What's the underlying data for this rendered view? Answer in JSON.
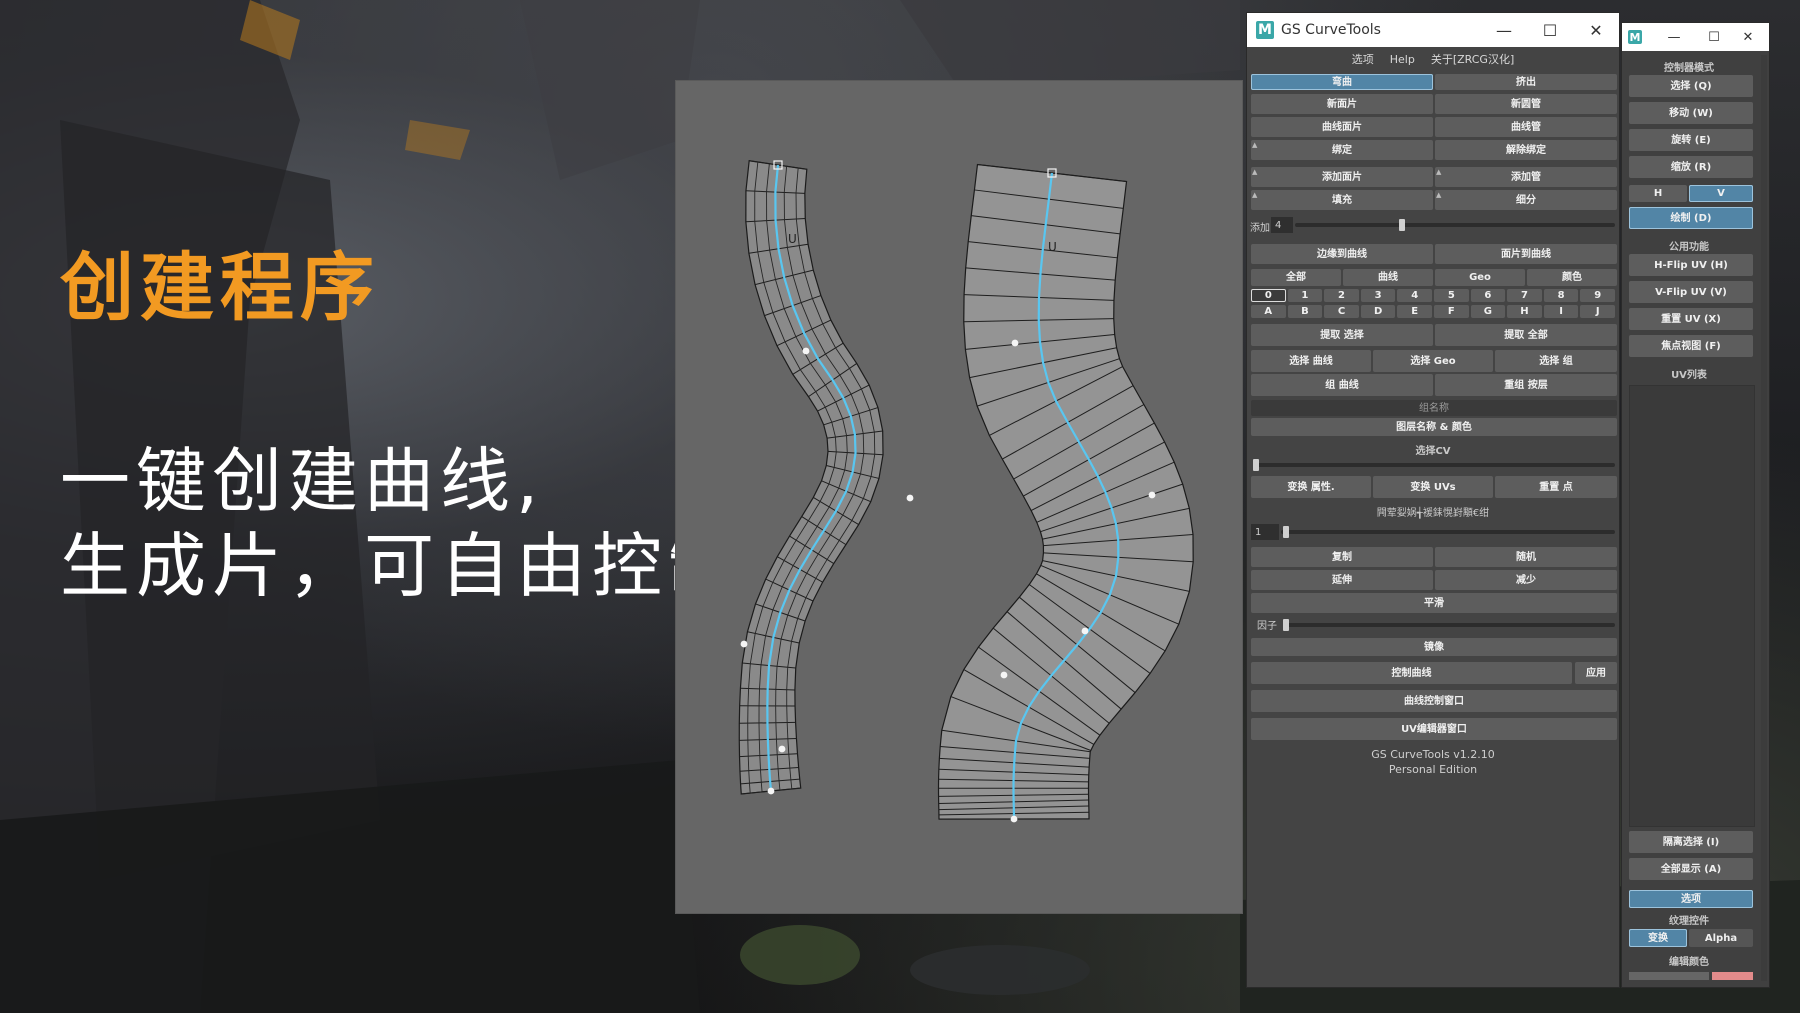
{
  "slide": {
    "headline": "创建程序",
    "subline_1": "一键创建曲线,",
    "subline_2": "生成片，可自由控制"
  },
  "colors": {
    "headline": "#f29a22",
    "curve": "#59c6f0",
    "active_button": "#5285a6",
    "panel": "#444444"
  },
  "viewport": {
    "marker_label": "U"
  },
  "main_window": {
    "title": "GS CurveTools",
    "menu": [
      "选项",
      "Help",
      "关于[ZRCG汉化]"
    ],
    "buttons": {
      "warp": "弯曲",
      "extrude": "挤出",
      "new_card": "新面片",
      "new_tube": "新圆管",
      "curve_card": "曲线面片",
      "curve_tube": "曲线管",
      "bind": "绑定",
      "unbind": "解除绑定",
      "add_card": "添加面片",
      "add_tube": "添加管",
      "fill": "填充",
      "subdivide": "细分",
      "edge_to_curve": "边缘到曲线",
      "card_to_curve": "面片到曲线",
      "filter_all": "全部",
      "filter_curve": "曲线",
      "filter_geo": "Geo",
      "filter_color": "颜色",
      "extract_selected": "提取 选择",
      "extract_all": "提取 全部",
      "select_curve": "选择 曲线",
      "select_geo": "选择 Geo",
      "select_group": "选择 组",
      "group_curve": "组 曲线",
      "regroup_layer": "重组 按层",
      "layer_names_colors": "图层名称 & 颜色",
      "transfer_attr": "变换 属性.",
      "transfer_uvs": "变换 UVs",
      "reset_pivot": "重置 点",
      "duplicate": "复制",
      "randomize": "随机",
      "extend": "延伸",
      "reduce": "减少",
      "smooth": "平滑",
      "mirror": "镜像",
      "control_curve": "控制曲线",
      "apply": "应用",
      "curve_control_window": "曲线控制窗口",
      "uv_editor_window": "UV编辑器窗口"
    },
    "add_label": "添加",
    "add_value": "4",
    "layer_numbers": [
      "0",
      "1",
      "2",
      "3",
      "4",
      "5",
      "6",
      "7",
      "8",
      "9"
    ],
    "layer_letters": [
      "A",
      "B",
      "C",
      "D",
      "E",
      "F",
      "G",
      "H",
      "I",
      "J"
    ],
    "group_name_placeholder": "组名称",
    "select_cv_label": "选择CV",
    "garbled_label": "闁荤姴娲╅褑銇愰崶顒€绀",
    "duplicate_value": "1",
    "factor_label": "因子",
    "footer_line1": "GS CurveTools v1.2.10",
    "footer_line2": "Personal Edition"
  },
  "uv_window": {
    "controller_mode_label": "控制器模式",
    "select": "选择 (Q)",
    "move": "移动 (W)",
    "rotate": "旋转 (E)",
    "scale": "缩放 (R)",
    "h": "H",
    "v": "V",
    "draw": "绘制 (D)",
    "utilities_label": "公用功能",
    "hflip": "H-Flip UV (H)",
    "vflip": "V-Flip UV (V)",
    "reset_uv": "重置 UV (X)",
    "focus_view": "焦点视图 (F)",
    "uv_list_label": "UV列表",
    "isolate_select": "隔离选择 (I)",
    "show_all": "全部显示 (A)",
    "options": "选项",
    "texture_controls_label": "纹理控件",
    "transform": "变换",
    "alpha": "Alpha",
    "edit_color_label": "编辑颜色"
  }
}
